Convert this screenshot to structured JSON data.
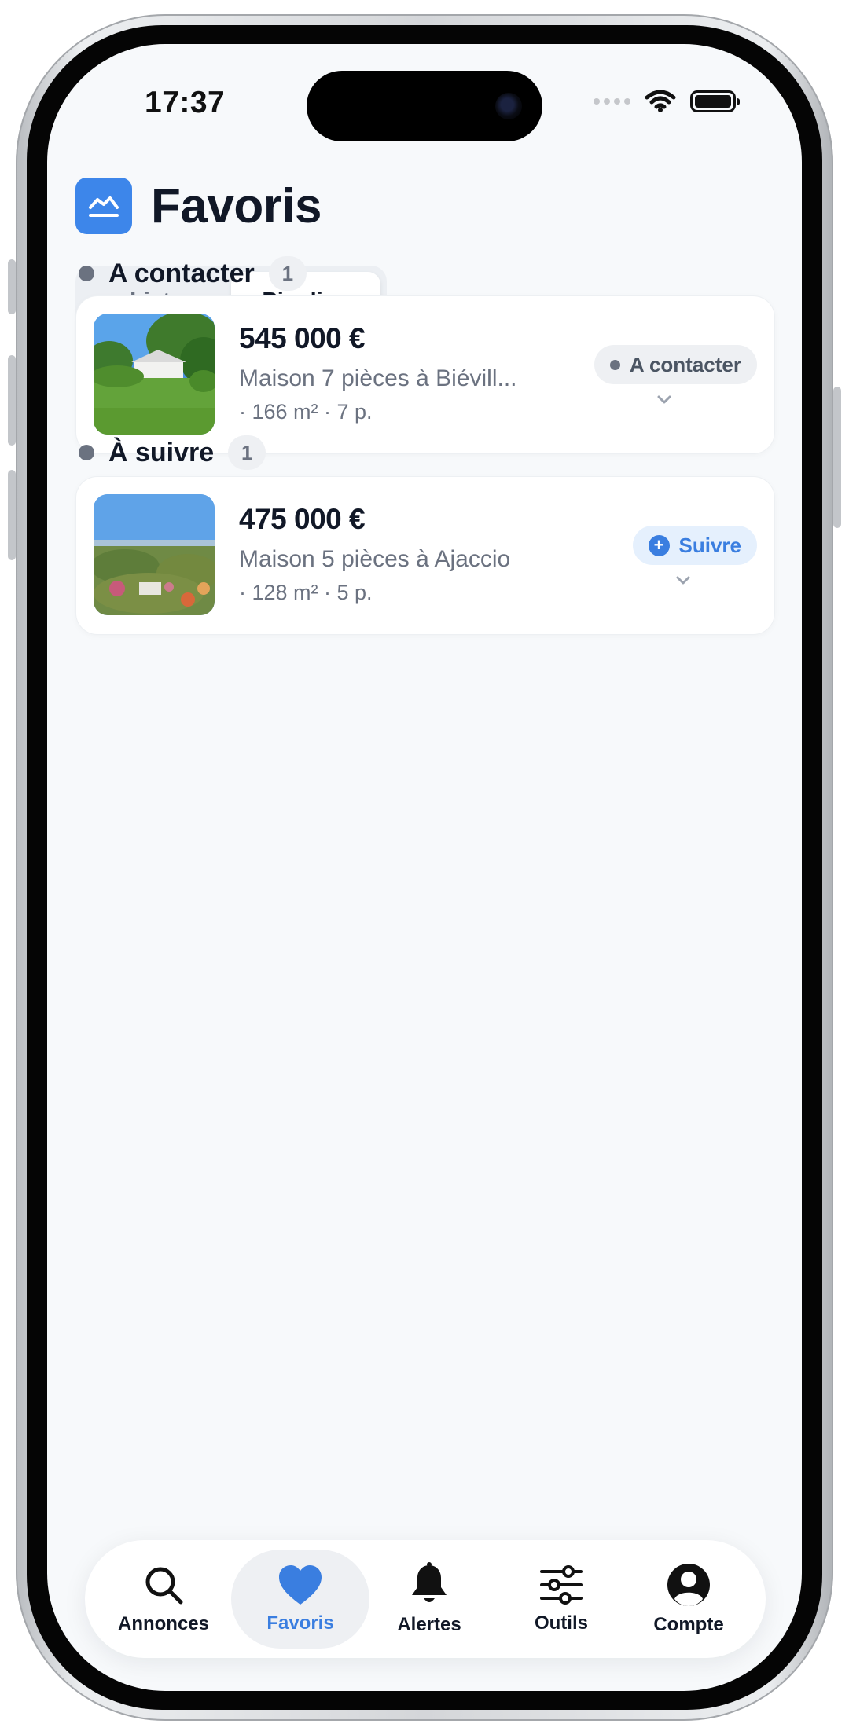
{
  "status_bar": {
    "time": "17:37"
  },
  "header": {
    "title": "Favoris"
  },
  "segmented": {
    "items": [
      "Liste",
      "Pipeline"
    ],
    "selected": "Pipeline"
  },
  "sections": [
    {
      "title": "A contacter",
      "count": "1",
      "listing": {
        "price": "545 000 €",
        "description": "Maison 7 pièces à Biévill...",
        "meta": "· 166 m² · 7 p.",
        "status_label": "A contacter"
      }
    },
    {
      "title": "À suivre",
      "count": "1",
      "listing": {
        "price": "475 000 €",
        "description": "Maison 5 pièces à Ajaccio",
        "meta": "· 128 m² · 5 p.",
        "status_label": "Suivre"
      }
    }
  ],
  "tabbar": {
    "items": [
      {
        "label": "Annonces",
        "icon": "search-icon"
      },
      {
        "label": "Favoris",
        "icon": "heart-icon"
      },
      {
        "label": "Alertes",
        "icon": "bell-icon"
      },
      {
        "label": "Outils",
        "icon": "sliders-icon"
      },
      {
        "label": "Compte",
        "icon": "user-circle-icon"
      }
    ],
    "selected": "Favoris"
  },
  "colors": {
    "accent": "#3a7ee0",
    "logo": "#3d86ea",
    "background": "#f7f9fb",
    "text_primary": "#111827",
    "text_secondary": "#6b7280"
  }
}
